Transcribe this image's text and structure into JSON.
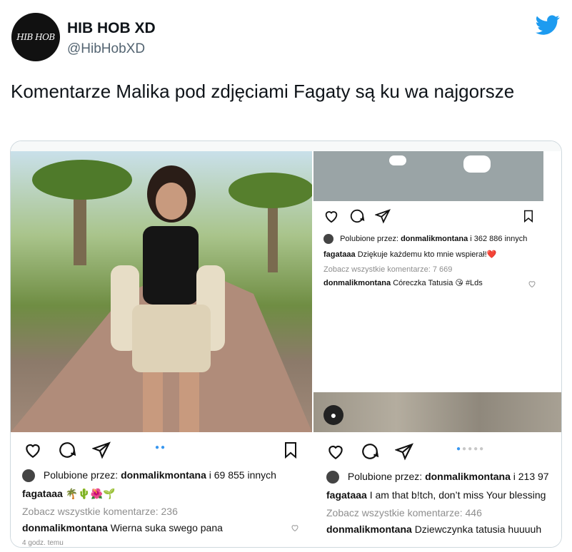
{
  "author": {
    "avatar_text": "HIB HOB",
    "name": "HIB HOB XD",
    "handle": "@HibHobXD"
  },
  "tweet": {
    "text": "Komentarze Malika pod zdjęciami Fagaty są ku wa najgorsze"
  },
  "right_post": {
    "likes_prefix": "Polubione przez:",
    "likes_user": "donmalikmontana",
    "likes_rest": "i 362 886 innych",
    "caption_user": "fagataaa",
    "caption_text": "Dziękuje każdemu kto mnie wspierał!❤️",
    "view_comments": "Zobacz wszystkie komentarze: 7 669",
    "comment_user": "donmalikmontana",
    "comment_text": "Córeczka Tatusia 😘 #Lds"
  },
  "bottom_left": {
    "likes_prefix": "Polubione przez:",
    "likes_user": "donmalikmontana",
    "likes_rest": "i 69 855 innych",
    "caption_user": "fagataaa",
    "caption_text": "🌴🌵🌺🌱",
    "view_comments": "Zobacz wszystkie komentarze: 236",
    "comment_user": "donmalikmontana",
    "comment_text": "Wierna suka swego pana",
    "timestamp": "4 godz. temu"
  },
  "bottom_right": {
    "likes_prefix": "Polubione przez:",
    "likes_user": "donmalikmontana",
    "likes_rest": "i 213 97",
    "caption_user": "fagataaa",
    "caption_text": "I am that b!tch, don’t miss Your blessing",
    "view_comments": "Zobacz wszystkie komentarze: 446",
    "comment_user": "donmalikmontana",
    "comment_text": "Dziewczynka tatusia huuuuh"
  },
  "colors": {
    "twitter_blue": "#1d9bf0",
    "ig_blue": "#3897f0"
  }
}
